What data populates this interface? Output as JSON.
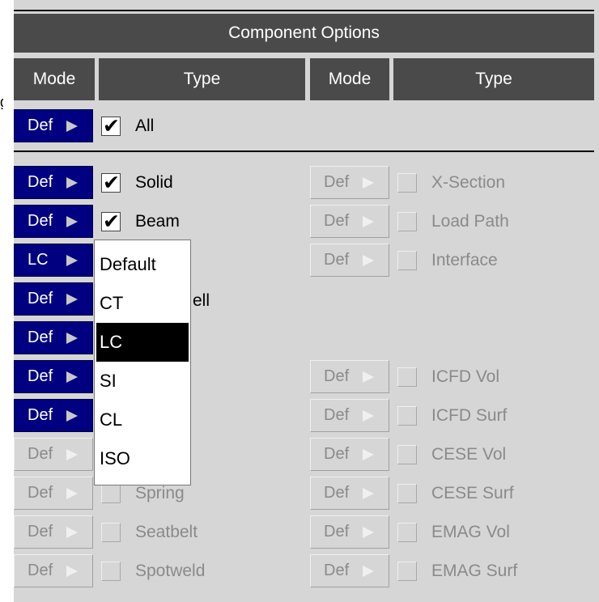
{
  "title": "Component Options",
  "columns": {
    "mode": "Mode",
    "type": "Type"
  },
  "edge_glyph": "g",
  "all_row": {
    "mode": "Def",
    "label": "All",
    "checked": true,
    "enabled": true
  },
  "left_rows": [
    {
      "mode": "Def",
      "label": "Solid",
      "checked": true,
      "enabled": true
    },
    {
      "mode": "Def",
      "label": "Beam",
      "checked": true,
      "enabled": true
    },
    {
      "mode": "LC",
      "label": "",
      "checked": false,
      "enabled": true
    },
    {
      "mode": "Def",
      "label": "",
      "checked": false,
      "enabled": true
    },
    {
      "mode": "Def",
      "label": "",
      "checked": false,
      "enabled": true
    },
    {
      "mode": "Def",
      "label": "",
      "checked": false,
      "enabled": true
    },
    {
      "mode": "Def",
      "label": "",
      "checked": false,
      "enabled": true
    },
    {
      "mode": "Def",
      "label": "",
      "checked": false,
      "enabled": false
    },
    {
      "mode": "Def",
      "label": "Spring",
      "checked": false,
      "enabled": false
    },
    {
      "mode": "Def",
      "label": "Seatbelt",
      "checked": false,
      "enabled": false
    },
    {
      "mode": "Def",
      "label": "Spotweld",
      "checked": false,
      "enabled": false
    }
  ],
  "partial_label": "ell",
  "right_rows": [
    {
      "slot": 0,
      "mode": "Def",
      "label": "X-Section",
      "enabled": false
    },
    {
      "slot": 1,
      "mode": "Def",
      "label": "Load Path",
      "enabled": false
    },
    {
      "slot": 2,
      "mode": "Def",
      "label": "Interface",
      "enabled": false
    },
    {
      "slot": 5,
      "mode": "Def",
      "label": "ICFD Vol",
      "enabled": false
    },
    {
      "slot": 6,
      "mode": "Def",
      "label": "ICFD Surf",
      "enabled": false
    },
    {
      "slot": 7,
      "mode": "Def",
      "label": "CESE Vol",
      "enabled": false
    },
    {
      "slot": 8,
      "mode": "Def",
      "label": "CESE Surf",
      "enabled": false
    },
    {
      "slot": 9,
      "mode": "Def",
      "label": "EMAG Vol",
      "enabled": false
    },
    {
      "slot": 10,
      "mode": "Def",
      "label": "EMAG Surf",
      "enabled": false
    }
  ],
  "popup": {
    "items": [
      "Default",
      "CT",
      "LC",
      "SI",
      "CL",
      "ISO"
    ],
    "selected": "LC"
  }
}
